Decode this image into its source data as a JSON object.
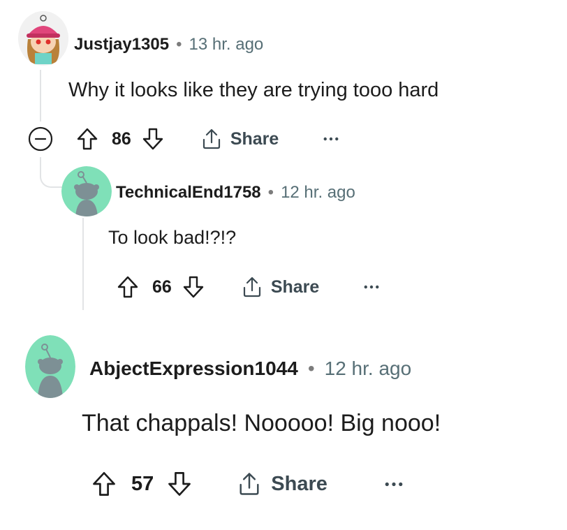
{
  "comments": [
    {
      "username": "Justjay1305",
      "separator": "•",
      "time": "13 hr. ago",
      "text": "Why it looks like they are trying tooo hard",
      "score": "86",
      "share_label": "Share",
      "avatar": "snoo-avatar-pink-hat"
    },
    {
      "username": "TechnicalEnd1758",
      "separator": "•",
      "time": "12 hr. ago",
      "text": "To look bad!?!?",
      "score": "66",
      "share_label": "Share",
      "avatar": "snoo-avatar-default-mint"
    },
    {
      "username": "AbjectExpression1044",
      "separator": "•",
      "time": "12 hr. ago",
      "text": "That chappals! Nooooo! Big nooo!",
      "score": "57",
      "share_label": "Share",
      "avatar": "snoo-avatar-default-mint"
    }
  ],
  "colors": {
    "text": "#1c1c1c",
    "meta": "#576f76",
    "thread_line": "#e2e4e6",
    "avatar_mint": "#7fe0b8"
  },
  "icons": [
    "collapse-icon",
    "upvote-icon",
    "downvote-icon",
    "share-icon",
    "more-options-icon"
  ]
}
